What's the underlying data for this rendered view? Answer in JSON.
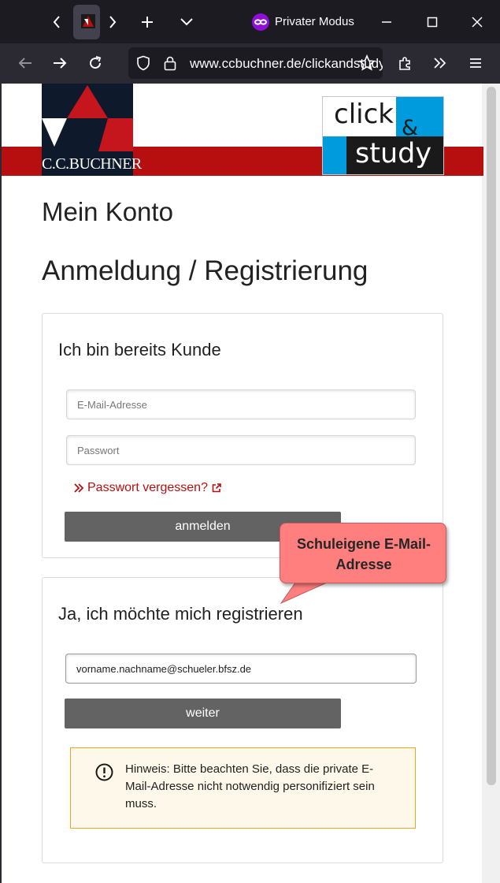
{
  "browser": {
    "private_label": "Privater Modus",
    "url": "www.ccbuchner.de/clickandstudy"
  },
  "header": {
    "logo_ccb_text": "C.C.BUCHNER",
    "logo_cs_click": "click",
    "logo_cs_amp": "&",
    "logo_cs_study": "study"
  },
  "page": {
    "title": "Mein Konto",
    "subtitle": "Anmeldung / Registrierung"
  },
  "login": {
    "heading": "Ich bin bereits Kunde",
    "email_placeholder": "E-Mail-Adresse",
    "password_placeholder": "Passwort",
    "forgot_label": "Passwort vergessen?",
    "submit_label": "anmelden"
  },
  "register": {
    "heading": "Ja, ich möchte mich registrieren",
    "email_value": "vorname.nachname@schueler.bfsz.de",
    "submit_label": "weiter",
    "notice_text": "Hinweis: Bitte beachten Sie, dass die private E-Mail-Adresse nicht notwendig personifiziert sein muss."
  },
  "callout": {
    "line1": "Schuleigene E-Mail-",
    "line2": "Adresse"
  },
  "colors": {
    "brand_red": "#b70f0f",
    "button_gray": "#636363",
    "callout_pink": "#ff7f7f",
    "notice_border": "#e8a921",
    "click_study_blue": "#009bdc"
  },
  "icons": [
    "back-tabs-icon",
    "forward-tabs-icon",
    "new-tab-icon",
    "tab-list-icon",
    "private-mask-icon",
    "minimize-icon",
    "maximize-icon",
    "close-icon",
    "back-icon",
    "forward-icon",
    "reload-icon",
    "shield-icon",
    "lock-icon",
    "bookmark-star-icon",
    "extensions-icon",
    "overflow-icon",
    "menu-icon",
    "double-chevron-icon",
    "external-link-icon",
    "exclamation-circle-icon"
  ]
}
